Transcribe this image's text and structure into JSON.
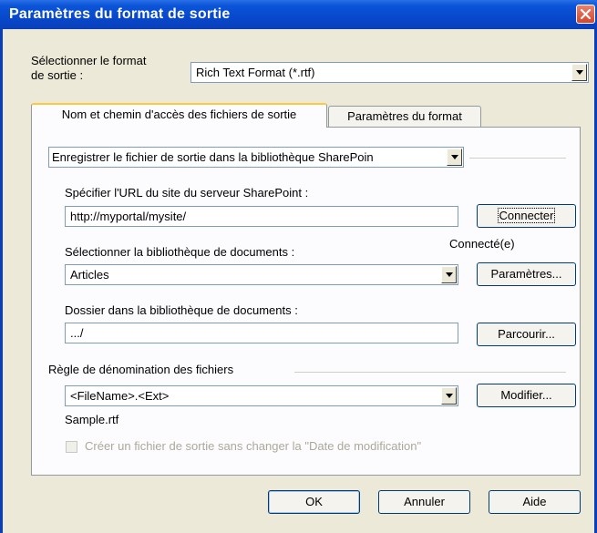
{
  "window": {
    "title": "Paramètres du format de sortie"
  },
  "format": {
    "label_line1": "Sélectionner le format",
    "label_line2": "de sortie :",
    "value": "Rich Text Format (*.rtf)"
  },
  "tabs": [
    {
      "label": "Nom et chemin d'accès des fichiers de sortie",
      "active": true
    },
    {
      "label": "Paramètres du format",
      "active": false
    }
  ],
  "destination": {
    "value": "Enregistrer le fichier de sortie dans la bibliothèque SharePoin"
  },
  "server_url": {
    "label": "Spécifier l'URL du site du serveur SharePoint :",
    "value": "http://myportal/mysite/",
    "connect_button": "Connecter",
    "status": "Connecté(e)"
  },
  "library": {
    "label": "Sélectionner la bibliothèque de documents :",
    "value": "Articles",
    "settings_button": "Paramètres..."
  },
  "folder": {
    "label": "Dossier dans la bibliothèque de documents :",
    "value": ".../",
    "browse_button": "Parcourir..."
  },
  "naming": {
    "label": "Règle de dénomination des fichiers",
    "value": "<FileName>.<Ext>",
    "modify_button": "Modifier...",
    "sample": "Sample.rtf"
  },
  "keep_date": {
    "label": "Créer un fichier de sortie sans changer la \"Date de modification\"",
    "checked": false,
    "enabled": false
  },
  "footer": {
    "ok": "OK",
    "cancel": "Annuler",
    "help": "Aide"
  },
  "colors": {
    "title_bar": "#0a54d8",
    "dialog_bg": "#ece9d8",
    "tab_highlight": "#ffc83c"
  }
}
